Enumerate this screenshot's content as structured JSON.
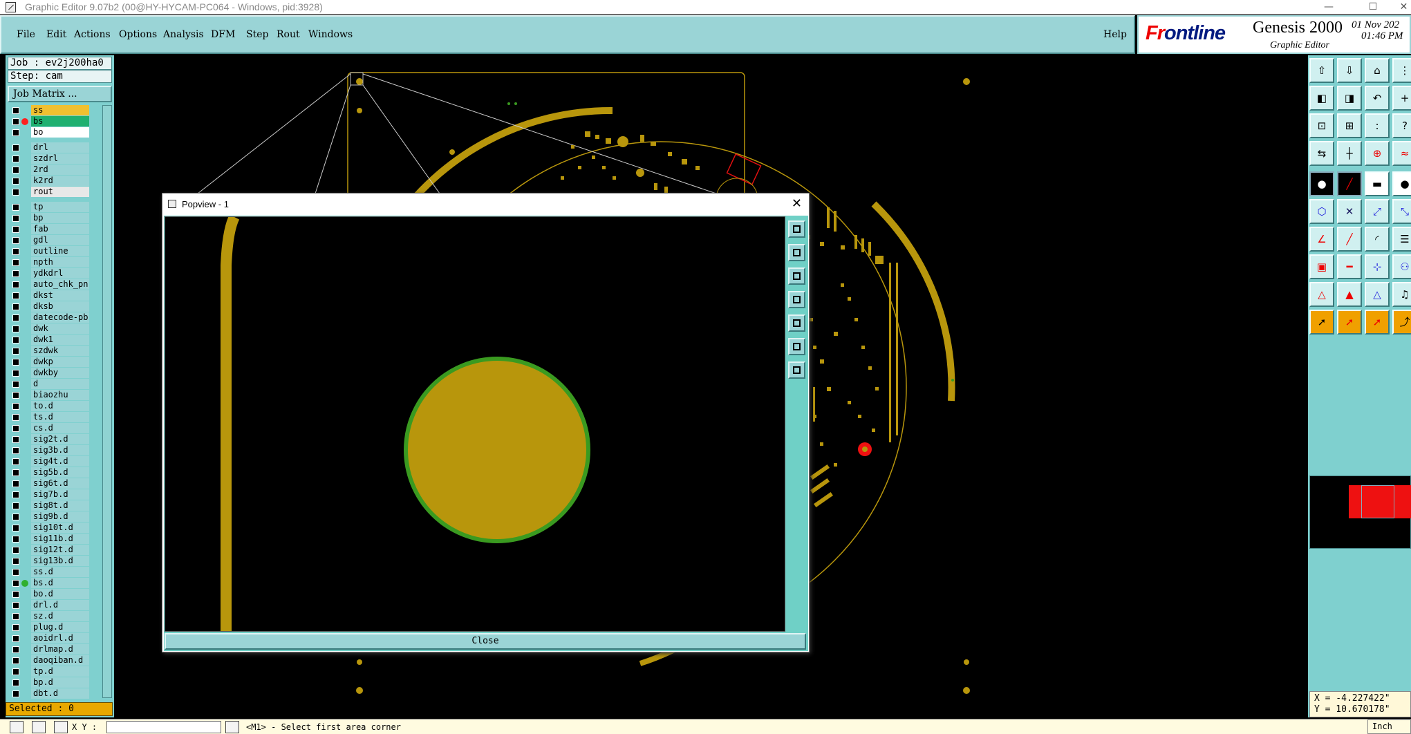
{
  "os": {
    "title": "Graphic Editor 9.07b2 (00@HY-HYCAM-PC064 - Windows, pid:3928)",
    "controls": [
      "minimize-glyph",
      "maximize-glyph",
      "close-glyph"
    ]
  },
  "menu": {
    "items": [
      "File",
      "Edit",
      "Actions",
      "Options",
      "Analysis",
      "DFM",
      "Step",
      "Rout",
      "Windows"
    ],
    "help": "Help"
  },
  "brand": {
    "logo_prefix": "Fr",
    "logo_rest": "ontline",
    "product": "Genesis 2000",
    "subtitle": "Graphic Editor",
    "date": "01 Nov 202",
    "time": "01:46 PM"
  },
  "job": {
    "job_line": "Job : ev2j200ha0",
    "step_line": "Step: cam",
    "matrix_button": "Job Matrix ..."
  },
  "layers": [
    {
      "name": "ss",
      "color": "#f0c030",
      "dot": ""
    },
    {
      "name": "bs",
      "color": "#20b070",
      "dot": "#ff2020"
    },
    {
      "name": "bo",
      "color": "#ffffff",
      "dot": ""
    },
    {
      "name": "drl",
      "color": "#9ad4d6",
      "dot": ""
    },
    {
      "name": "szdrl",
      "color": "#9ad4d6",
      "dot": ""
    },
    {
      "name": "2rd",
      "color": "#9ad4d6",
      "dot": ""
    },
    {
      "name": "k2rd",
      "color": "#9ad4d6",
      "dot": ""
    },
    {
      "name": "rout",
      "color": "#e8e8e8",
      "dot": ""
    },
    {
      "name": "tp",
      "color": "#9ad4d6",
      "dot": ""
    },
    {
      "name": "bp",
      "color": "#9ad4d6",
      "dot": ""
    },
    {
      "name": "fab",
      "color": "#9ad4d6",
      "dot": ""
    },
    {
      "name": "gdl",
      "color": "#9ad4d6",
      "dot": ""
    },
    {
      "name": "outline",
      "color": "#9ad4d6",
      "dot": ""
    },
    {
      "name": "npth",
      "color": "#9ad4d6",
      "dot": ""
    },
    {
      "name": "ydkdrl",
      "color": "#9ad4d6",
      "dot": ""
    },
    {
      "name": "auto_chk_pn",
      "color": "#9ad4d6",
      "dot": ""
    },
    {
      "name": "dkst",
      "color": "#9ad4d6",
      "dot": ""
    },
    {
      "name": "dksb",
      "color": "#9ad4d6",
      "dot": ""
    },
    {
      "name": "datecode-pb",
      "color": "#9ad4d6",
      "dot": ""
    },
    {
      "name": "dwk",
      "color": "#9ad4d6",
      "dot": ""
    },
    {
      "name": "dwk1",
      "color": "#9ad4d6",
      "dot": ""
    },
    {
      "name": "szdwk",
      "color": "#9ad4d6",
      "dot": ""
    },
    {
      "name": "dwkp",
      "color": "#9ad4d6",
      "dot": ""
    },
    {
      "name": "dwkby",
      "color": "#9ad4d6",
      "dot": ""
    },
    {
      "name": "d",
      "color": "#9ad4d6",
      "dot": ""
    },
    {
      "name": "biaozhu",
      "color": "#9ad4d6",
      "dot": ""
    },
    {
      "name": "to.d",
      "color": "#9ad4d6",
      "dot": ""
    },
    {
      "name": "ts.d",
      "color": "#9ad4d6",
      "dot": ""
    },
    {
      "name": "cs.d",
      "color": "#9ad4d6",
      "dot": ""
    },
    {
      "name": "sig2t.d",
      "color": "#9ad4d6",
      "dot": ""
    },
    {
      "name": "sig3b.d",
      "color": "#9ad4d6",
      "dot": ""
    },
    {
      "name": "sig4t.d",
      "color": "#9ad4d6",
      "dot": ""
    },
    {
      "name": "sig5b.d",
      "color": "#9ad4d6",
      "dot": ""
    },
    {
      "name": "sig6t.d",
      "color": "#9ad4d6",
      "dot": ""
    },
    {
      "name": "sig7b.d",
      "color": "#9ad4d6",
      "dot": ""
    },
    {
      "name": "sig8t.d",
      "color": "#9ad4d6",
      "dot": ""
    },
    {
      "name": "sig9b.d",
      "color": "#9ad4d6",
      "dot": ""
    },
    {
      "name": "sig10t.d",
      "color": "#9ad4d6",
      "dot": ""
    },
    {
      "name": "sig11b.d",
      "color": "#9ad4d6",
      "dot": ""
    },
    {
      "name": "sig12t.d",
      "color": "#9ad4d6",
      "dot": ""
    },
    {
      "name": "sig13b.d",
      "color": "#9ad4d6",
      "dot": ""
    },
    {
      "name": "ss.d",
      "color": "#9ad4d6",
      "dot": ""
    },
    {
      "name": "bs.d",
      "color": "#9ad4d6",
      "dot": "#30b030"
    },
    {
      "name": "bo.d",
      "color": "#9ad4d6",
      "dot": ""
    },
    {
      "name": "drl.d",
      "color": "#9ad4d6",
      "dot": ""
    },
    {
      "name": "sz.d",
      "color": "#9ad4d6",
      "dot": ""
    },
    {
      "name": "plug.d",
      "color": "#9ad4d6",
      "dot": ""
    },
    {
      "name": "aoidrl.d",
      "color": "#9ad4d6",
      "dot": ""
    },
    {
      "name": "drlmap.d",
      "color": "#9ad4d6",
      "dot": ""
    },
    {
      "name": "daoqiban.d",
      "color": "#9ad4d6",
      "dot": ""
    },
    {
      "name": "tp.d",
      "color": "#9ad4d6",
      "dot": ""
    },
    {
      "name": "bp.d",
      "color": "#9ad4d6",
      "dot": ""
    },
    {
      "name": "dbt.d",
      "color": "#9ad4d6",
      "dot": ""
    }
  ],
  "selected": "Selected : 0",
  "status": {
    "xy_label": "X Y :",
    "xy_value": "",
    "prompt": "<M1> - Select first area corner",
    "unit": "Inch"
  },
  "popview": {
    "title": "Popview - 1",
    "close_glyph": "✕",
    "close_button": "Close"
  },
  "coords": {
    "x": "X = -4.227422\"",
    "y": "Y = 10.670178\""
  },
  "colors": {
    "copper": "#b8960c",
    "mask_green": "#3a9a20",
    "panel_teal": "#9ad4d6",
    "marker_red": "#ee1111"
  }
}
